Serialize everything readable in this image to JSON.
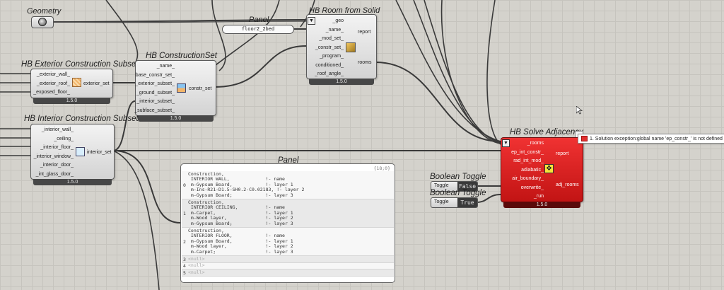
{
  "geometry": {
    "title": "Geometry"
  },
  "panel_small": {
    "title": "Panel",
    "value": "floor2_2bed"
  },
  "hb_room": {
    "title": "HB Room from Solid",
    "inputs": [
      "_geo",
      "_name_",
      "_mod_set_",
      "_constr_set_",
      "_program_",
      "conditioned_",
      "_roof_angle_"
    ],
    "outputs": [
      "report",
      "rooms"
    ],
    "version": "1.5.0"
  },
  "ext_subset": {
    "title": "HB Exterior Construction Subset",
    "inputs": [
      "_exterior_wall_",
      "_exterior_roof_",
      "_exposed_floor_"
    ],
    "output": "exterior_set",
    "version": "1.5.0"
  },
  "constr_set": {
    "title": "HB ConstructionSet",
    "inputs": [
      "_name_",
      "base_constr_set_",
      "_exterior_subset_",
      "_ground_subset_",
      "_interior_subset_",
      "_subface_subset_"
    ],
    "output": "constr_set",
    "version": "1.5.0"
  },
  "int_subset": {
    "title": "HB Interior Construction Subset",
    "inputs": [
      "_interior_wall_",
      "_ceiling_",
      "_interior_floor_",
      "_interior_window_",
      "_interior_door_",
      "_int_glass_door_"
    ],
    "output": "interior_set",
    "version": "1.5.0"
  },
  "panel_big": {
    "title": "Panel",
    "header": "{18;0}",
    "rows": [
      {
        "num": "0",
        "lines": [
          "Construction,",
          " INTERIOR WALL,             !- name",
          " m-Gypsum Board,            !- layer 1",
          " m-Ins-R21-D1.5-SH0.2-C0.02183, !- layer 2",
          " m-Gypsum Board;            !- layer 3"
        ]
      },
      {
        "num": "1",
        "lines": [
          "Construction,",
          " INTERIOR CEILING,          !- name",
          " m-Carpet,                  !- layer 1",
          " m-Wood layer,              !- layer 2",
          " m-Gypsum Board;            !- layer 3"
        ]
      },
      {
        "num": "2",
        "lines": [
          "Construction,",
          " INTERIOR FLOOR,            !- name",
          " m-Gypsum Board,            !- layer 1",
          " m-Wood layer,              !- layer 2",
          " m-Carpet;                  !- layer 3"
        ]
      },
      {
        "num": "3",
        "lines": [
          "<null>"
        ]
      },
      {
        "num": "4",
        "lines": [
          "<null>"
        ]
      },
      {
        "num": "5",
        "lines": [
          "<null>"
        ]
      }
    ]
  },
  "toggle1": {
    "title": "Boolean Toggle",
    "label": "Toggle",
    "value": "False"
  },
  "toggle2": {
    "title": "Boolean Toggle",
    "label": "Toggle",
    "value": "True"
  },
  "solve_adj": {
    "title": "HB Solve Adjacency",
    "inputs": [
      "_rooms",
      "ep_int_constr_",
      "rad_int_mod_",
      "adiabatic_",
      "air_boundary_",
      "overwrite_",
      "_run"
    ],
    "outputs": [
      "report",
      "adj_rooms"
    ],
    "version": "1.5.0",
    "error": "1. Solution exception:global name 'ep_constr_' is not defined"
  },
  "colors": {
    "error_red": "#d91e1e",
    "canvas": "#d4d2cc"
  },
  "icons": [
    "sphere-icon",
    "hb-room-icon",
    "exterior-set-icon",
    "constr-set-icon",
    "interior-set-icon",
    "adjacency-icon",
    "error-icon",
    "mouse-cursor-icon"
  ]
}
